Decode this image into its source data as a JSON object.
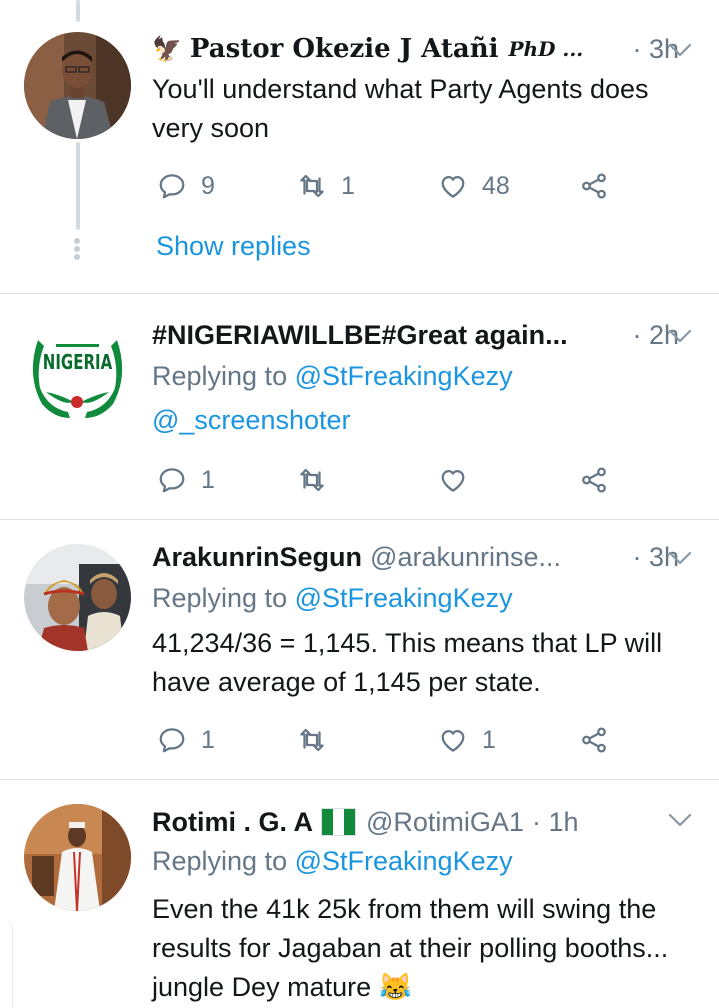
{
  "tweets": [
    {
      "author": "Pastor Okezie J Atañi",
      "author_suffix": "PhD ...",
      "time": "· 3h",
      "body": "You'll understand what Party Agents does very soon",
      "replies": "9",
      "retweets": "1",
      "likes": "48",
      "show_replies": "Show replies"
    },
    {
      "author": "#NIGERIAWILLBE#Great again...",
      "time": "· 2h",
      "reply_prefix": "Replying to",
      "reply_to": "@StFreakingKezy",
      "reply_to_2": "@_screenshoter",
      "avatar_text": "NIGERIA",
      "replies": "1",
      "retweets": "",
      "likes": ""
    },
    {
      "author": "ArakunrinSegun",
      "handle": "@arakunrinse...",
      "time": "· 3h",
      "reply_prefix": "Replying to",
      "reply_to": "@StFreakingKezy",
      "body": "41,234/36 = 1,145. This means that LP will have average of 1,145 per state.",
      "replies": "1",
      "retweets": "",
      "likes": "1"
    },
    {
      "author": "Rotimi . G. A",
      "handle": "@RotimiGA1",
      "time": "· 1h",
      "reply_prefix": "Replying to",
      "reply_to": "@StFreakingKezy",
      "body": "Even the 41k 25k from them will swing the results for Jagaban at their polling booths... jungle Dey mature 😹"
    }
  ],
  "icons": [
    "eagle-emoji-icon",
    "nigeria-flag-icon",
    "reply-icon",
    "retweet-icon",
    "like-icon",
    "share-icon",
    "chevron-down-icon"
  ],
  "colors": {
    "link": "#1b95e0",
    "muted": "#657786",
    "text": "#14171a",
    "divider": "#dfe3e6",
    "nigeria_green": "#118a3c"
  }
}
